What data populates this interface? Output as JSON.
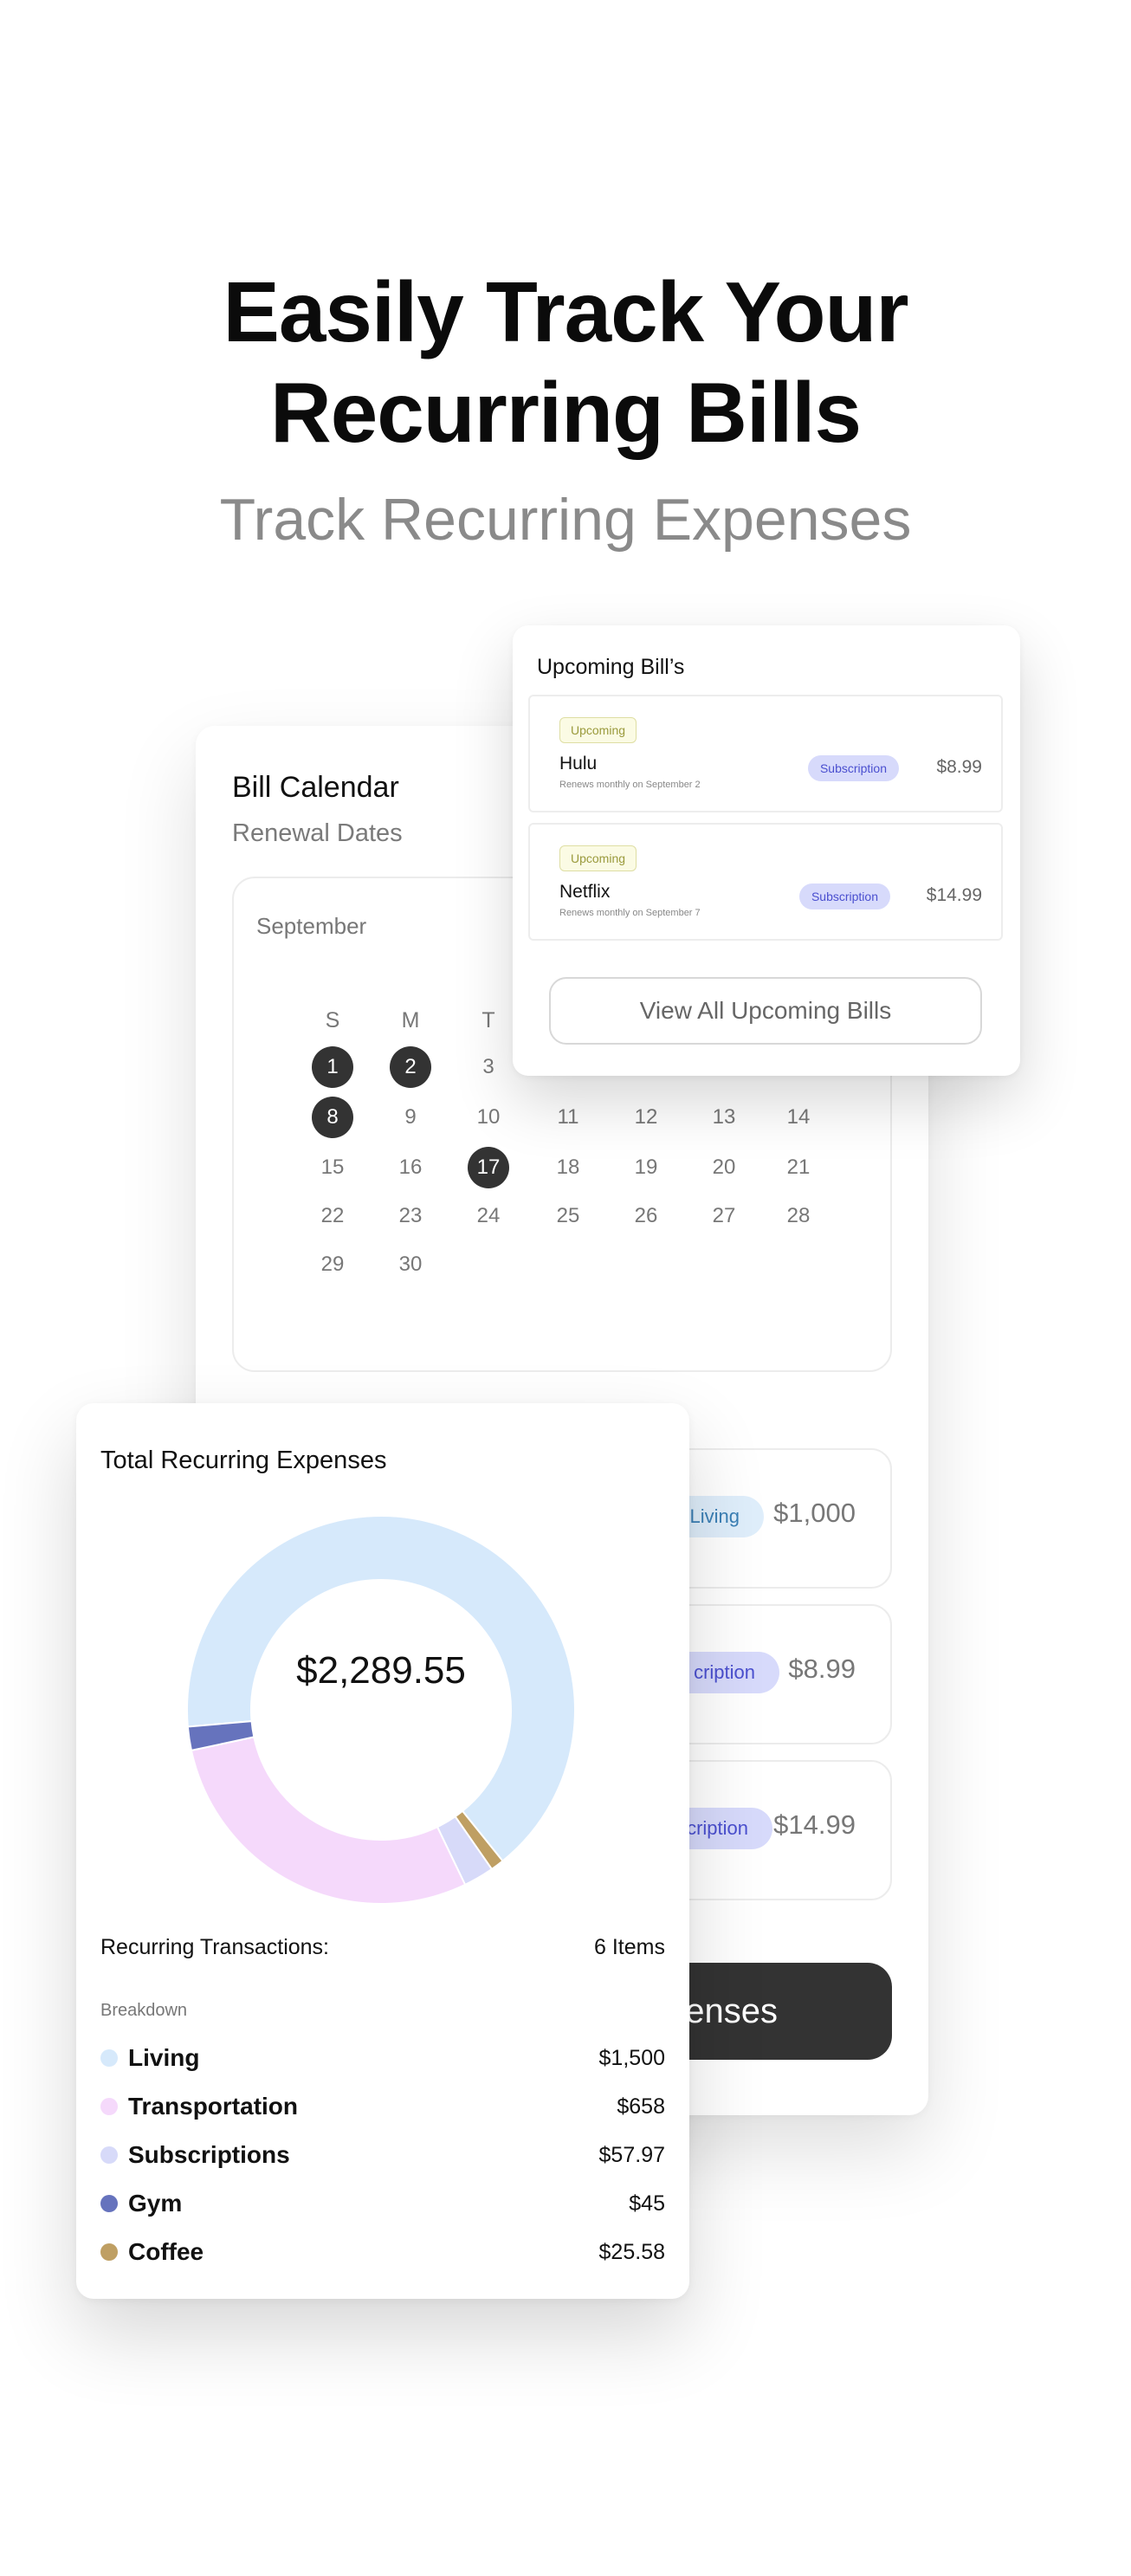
{
  "hero": {
    "title_line1": "Easily Track Your",
    "title_line2": "Recurring Bills",
    "subtitle": "Track Recurring Expenses"
  },
  "calendar": {
    "title": "Bill Calendar",
    "subtitle": "Renewal Dates",
    "month": "September",
    "weekdays": [
      "S",
      "M",
      "T"
    ],
    "days": [
      "1",
      "2",
      "3",
      "8",
      "9",
      "10",
      "11",
      "12",
      "13",
      "14",
      "15",
      "16",
      "17",
      "18",
      "19",
      "20",
      "21",
      "22",
      "23",
      "24",
      "25",
      "26",
      "27",
      "28",
      "29",
      "30"
    ],
    "highlighted_days": [
      "1",
      "2",
      "8",
      "17"
    ]
  },
  "transactions": {
    "rows": [
      {
        "category": "Living",
        "amount": "$1,000",
        "category_color": "#dfeefb"
      },
      {
        "category": "cription",
        "amount": "$8.99",
        "category_color": "#d7dafb"
      },
      {
        "category": "cription",
        "amount": "$14.99",
        "category_color": "#d7dafb"
      }
    ],
    "button_label": "enses"
  },
  "upcoming": {
    "title": "Upcoming Bill’s",
    "bills": [
      {
        "status": "Upcoming",
        "name": "Hulu",
        "renews": "Renews monthly on September 2",
        "category": "Subscription",
        "amount": "$8.99"
      },
      {
        "status": "Upcoming",
        "name": "Netflix",
        "renews": "Renews monthly on September 7",
        "category": "Subscription",
        "amount": "$14.99"
      }
    ],
    "view_all_label": "View All Upcoming Bills"
  },
  "total": {
    "title": "Total Recurring Expenses",
    "center_amount": "$2,289.55",
    "recurring_label": "Recurring Transactions:",
    "recurring_count": "6 Items",
    "breakdown_label": "Breakdown",
    "legend": [
      {
        "name": "Living",
        "amount": "$1,500",
        "color": "#d6e9fb"
      },
      {
        "name": "Transportation",
        "amount": "$658",
        "color": "#f5d9fb"
      },
      {
        "name": "Subscriptions",
        "amount": "$57.97",
        "color": "#d7daf9"
      },
      {
        "name": "Gym",
        "amount": "$45",
        "color": "#6673bd"
      },
      {
        "name": "Coffee",
        "amount": "$25.58",
        "color": "#bf9f63"
      }
    ]
  },
  "chart_data": {
    "type": "pie",
    "title": "Total Recurring Expenses",
    "categories": [
      "Living",
      "Coffee",
      "Subscriptions",
      "Transportation",
      "Gym"
    ],
    "values": [
      1500,
      25.58,
      57.97,
      658,
      45
    ],
    "colors": [
      "#d6e9fb",
      "#bf9f63",
      "#d7daf9",
      "#f5d9fb",
      "#6673bd"
    ]
  }
}
